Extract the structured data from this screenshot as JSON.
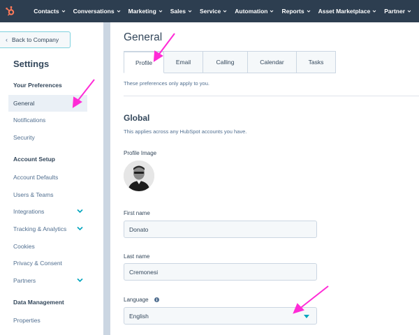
{
  "colors": {
    "nav_bg": "#2d3e50",
    "accent": "#00a4bd",
    "brand_orange": "#ff7a59",
    "annotation": "#ff2bd6",
    "text": "#33475b"
  },
  "topnav": {
    "logo_icon": "hubspot-sprocket-icon",
    "items": [
      {
        "label": "Contacts"
      },
      {
        "label": "Conversations"
      },
      {
        "label": "Marketing"
      },
      {
        "label": "Sales"
      },
      {
        "label": "Service"
      },
      {
        "label": "Automation"
      },
      {
        "label": "Reports"
      },
      {
        "label": "Asset Marketplace"
      },
      {
        "label": "Partner"
      }
    ]
  },
  "sidebar": {
    "back_label": "Back to Company",
    "title": "Settings",
    "sections": [
      {
        "heading": "Your Preferences",
        "items": [
          {
            "label": "General",
            "active": true
          },
          {
            "label": "Notifications"
          },
          {
            "label": "Security"
          }
        ]
      },
      {
        "heading": "Account Setup",
        "items": [
          {
            "label": "Account Defaults"
          },
          {
            "label": "Users & Teams"
          },
          {
            "label": "Integrations",
            "expandable": true
          },
          {
            "label": "Tracking & Analytics",
            "expandable": true
          },
          {
            "label": "Cookies"
          },
          {
            "label": "Privacy & Consent"
          },
          {
            "label": "Partners",
            "expandable": true
          }
        ]
      },
      {
        "heading": "Data Management",
        "items": [
          {
            "label": "Properties"
          }
        ]
      }
    ]
  },
  "main": {
    "title": "General",
    "tabs": [
      {
        "label": "Profile",
        "active": true
      },
      {
        "label": "Email"
      },
      {
        "label": "Calling"
      },
      {
        "label": "Calendar"
      },
      {
        "label": "Tasks"
      }
    ],
    "pref_note": "These preferences only apply to you.",
    "global": {
      "title": "Global",
      "subtitle": "This applies across any HubSpot accounts you have.",
      "profile_image_label": "Profile Image",
      "first_name_label": "First name",
      "first_name_value": "Donato",
      "last_name_label": "Last name",
      "last_name_value": "Cremonesi",
      "language_label": "Language",
      "language_value": "English"
    }
  }
}
